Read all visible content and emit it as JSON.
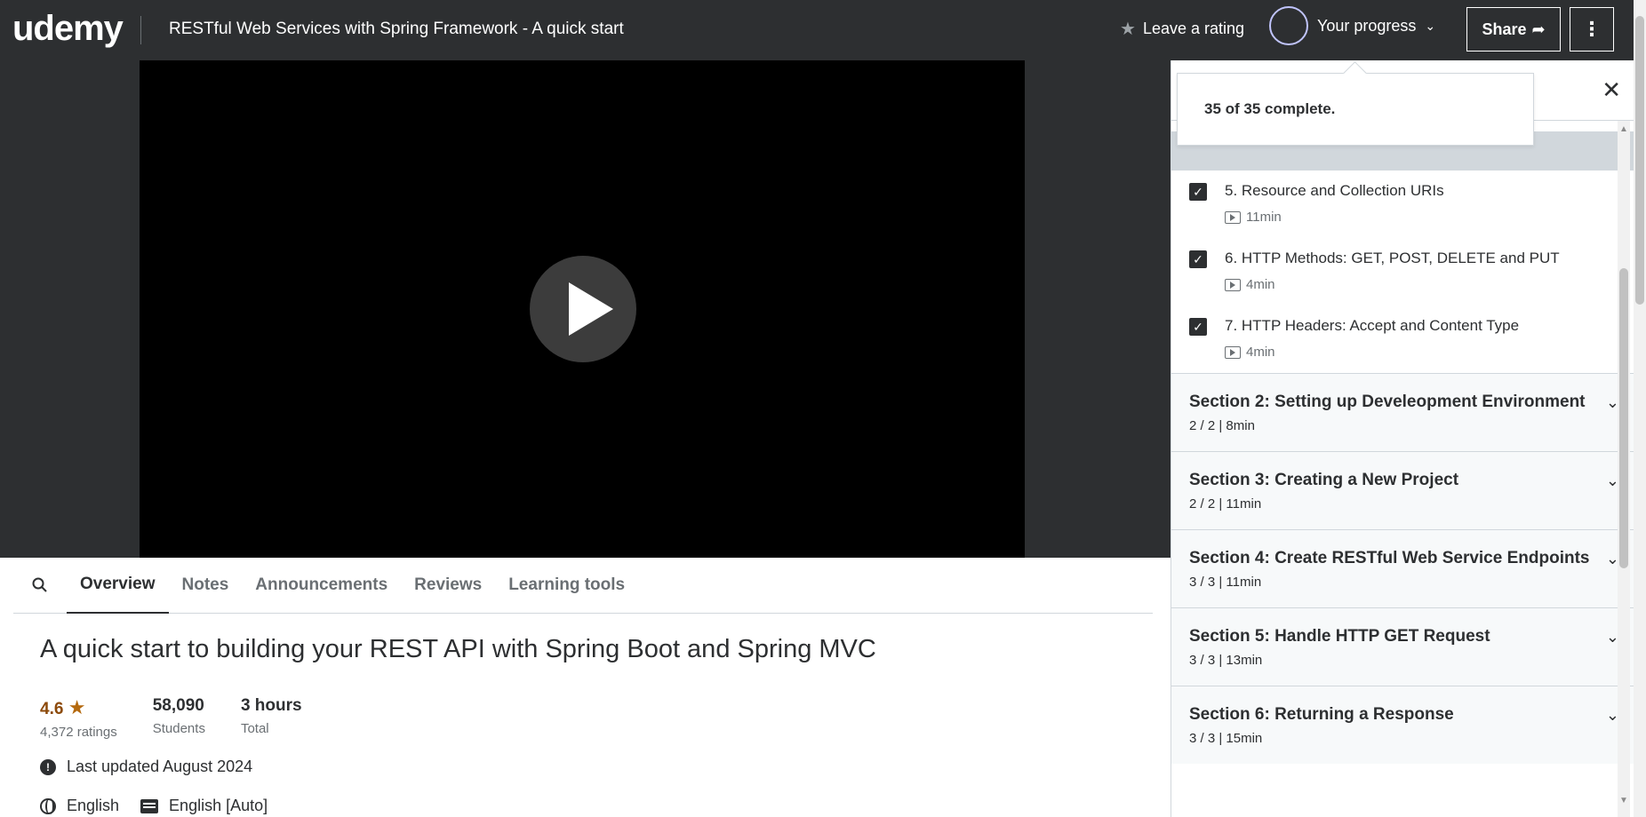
{
  "header": {
    "logo": "udemy",
    "course_title": "RESTful Web Services with Spring Framework - A quick start",
    "rating_label": "Leave a rating",
    "progress_label": "Your progress",
    "share_label": "Share",
    "more_icon": "vertical-dots-icon"
  },
  "progress_tooltip": {
    "text": "35 of 35 complete."
  },
  "tabs": [
    {
      "label": "Overview",
      "active": true
    },
    {
      "label": "Notes"
    },
    {
      "label": "Announcements"
    },
    {
      "label": "Reviews"
    },
    {
      "label": "Learning tools"
    }
  ],
  "overview": {
    "headline": "A quick start to building your REST API with Spring Boot and Spring MVC",
    "rating": "4.6",
    "rating_count": "4,372 ratings",
    "students_value": "58,090",
    "students_label": "Students",
    "duration_value": "3 hours",
    "duration_label": "Total",
    "last_updated": "Last updated August 2024",
    "language": "English",
    "captions": "English [Auto]"
  },
  "sidebar": {
    "current_lecture_duration": "11min",
    "lectures": [
      {
        "title": "5. Resource and Collection URIs",
        "duration": "11min",
        "checked": true
      },
      {
        "title": "6. HTTP Methods: GET, POST, DELETE and PUT",
        "duration": "4min",
        "checked": true
      },
      {
        "title": "7. HTTP Headers: Accept and Content Type",
        "duration": "4min",
        "checked": true
      }
    ],
    "sections": [
      {
        "title": "Section 2: Setting up Develeopment Environment",
        "meta": "2 / 2 | 8min"
      },
      {
        "title": "Section 3: Creating a New Project",
        "meta": "2 / 2 | 11min"
      },
      {
        "title": "Section 4: Create RESTful Web Service Endpoints",
        "meta": "3 / 3 | 11min"
      },
      {
        "title": "Section 5: Handle HTTP GET Request",
        "meta": "3 / 3 | 13min"
      },
      {
        "title": "Section 6: Returning a Response",
        "meta": "3 / 3 | 15min"
      }
    ]
  },
  "colors": {
    "header_bg": "#2d2f31",
    "accent": "#a435f0",
    "rating": "#b4690e"
  }
}
